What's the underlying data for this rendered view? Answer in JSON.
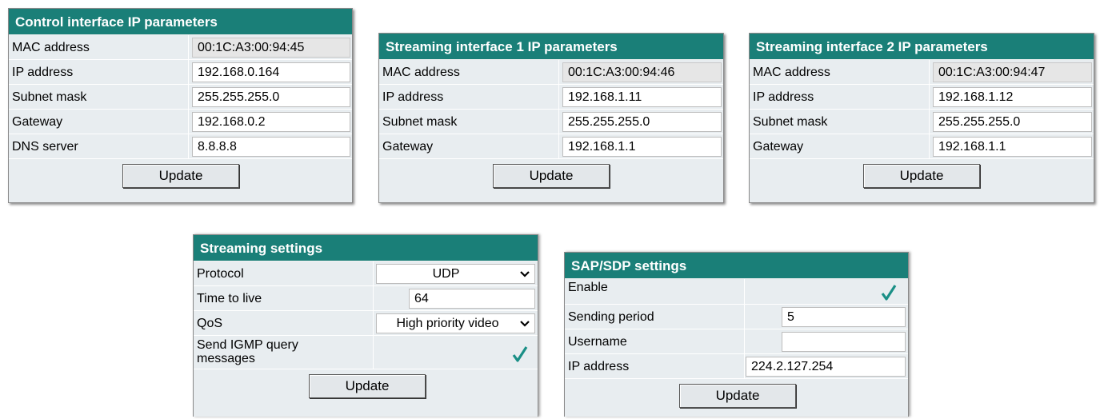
{
  "control_panel": {
    "title": "Control interface IP parameters",
    "rows": [
      {
        "label": "MAC address",
        "value": "00:1C:A3:00:94:45",
        "readonly": true
      },
      {
        "label": "IP address",
        "value": "192.168.0.164"
      },
      {
        "label": "Subnet mask",
        "value": "255.255.255.0"
      },
      {
        "label": "Gateway",
        "value": "192.168.0.2"
      },
      {
        "label": "DNS server",
        "value": "8.8.8.8"
      }
    ],
    "button": "Update"
  },
  "stream1_panel": {
    "title": "Streaming interface 1 IP parameters",
    "rows": [
      {
        "label": "MAC address",
        "value": "00:1C:A3:00:94:46",
        "readonly": true
      },
      {
        "label": "IP address",
        "value": "192.168.1.11"
      },
      {
        "label": "Subnet mask",
        "value": "255.255.255.0"
      },
      {
        "label": "Gateway",
        "value": "192.168.1.1"
      }
    ],
    "button": "Update"
  },
  "stream2_panel": {
    "title": "Streaming interface 2 IP parameters",
    "rows": [
      {
        "label": "MAC address",
        "value": "00:1C:A3:00:94:47",
        "readonly": true
      },
      {
        "label": "IP address",
        "value": "192.168.1.12"
      },
      {
        "label": "Subnet mask",
        "value": "255.255.255.0"
      },
      {
        "label": "Gateway",
        "value": "192.168.1.1"
      }
    ],
    "button": "Update"
  },
  "streaming_settings": {
    "title": "Streaming settings",
    "protocol_label": "Protocol",
    "protocol_value": "UDP",
    "ttl_label": "Time to live",
    "ttl_value": "64",
    "qos_label": "QoS",
    "qos_value": "High priority video",
    "igmp_label_line1": "Send IGMP query",
    "igmp_label_line2": "messages",
    "igmp_checked": true,
    "button": "Update"
  },
  "sap_sdp_settings": {
    "title": "SAP/SDP settings",
    "enable_label": "Enable",
    "enable_checked": true,
    "period_label": "Sending period",
    "period_value": "5",
    "username_label": "Username",
    "username_value": "",
    "ip_label": "IP address",
    "ip_value": "224.2.127.254",
    "button": "Update"
  },
  "colors": {
    "title_bar": "#1a7f78",
    "panel_bg": "#e8edf0",
    "check": "#1a8f86"
  },
  "icons": {
    "dropdown": "chevron-down-icon",
    "checkbox": "checkmark-icon"
  }
}
